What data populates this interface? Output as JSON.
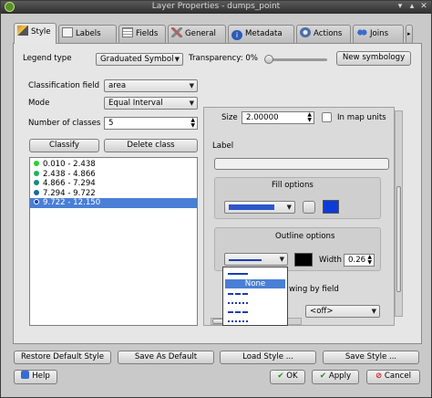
{
  "window": {
    "title": "Layer Properties - dumps_point"
  },
  "tabs": [
    {
      "label": "Style"
    },
    {
      "label": "Labels"
    },
    {
      "label": "Fields"
    },
    {
      "label": "General"
    },
    {
      "label": "Metadata"
    },
    {
      "label": "Actions"
    },
    {
      "label": "Joins"
    }
  ],
  "legend": {
    "label": "Legend type",
    "value": "Graduated Symbol",
    "transparency_label": "Transparency: 0%",
    "transparency": 0,
    "new_symbology": "New symbology"
  },
  "classification": {
    "field_label": "Classification field",
    "field_value": "area",
    "mode_label": "Mode",
    "mode_value": "Equal Interval",
    "classes_label": "Number of classes",
    "classes_value": "5",
    "classify": "Classify",
    "delete_class": "Delete class"
  },
  "classes": [
    {
      "label": "0.010 - 2.438",
      "color": "#2bd12b"
    },
    {
      "label": "2.438 - 4.866",
      "color": "#22b061"
    },
    {
      "label": "4.866 - 7.294",
      "color": "#178a7a"
    },
    {
      "label": "7.294 - 9.722",
      "color": "#156b9c"
    },
    {
      "label": "9.722 - 12.150",
      "color": "#1c3fc0"
    }
  ],
  "selected_class_index": 4,
  "symbol": {
    "size_label": "Size",
    "size_value": "2.00000",
    "in_map_units": "In map units",
    "label_label": "Label",
    "label_value": "",
    "fill_options": "Fill options",
    "fill_color": "#0e3bd8",
    "outline_options": "Outline options",
    "outline_color": "#000000",
    "width_label": "Width",
    "width_value": "0.26",
    "drawing_by_field": "wing by field",
    "off": "<off>"
  },
  "popup": {
    "none": "None"
  },
  "bottom": {
    "restore": "Restore Default Style",
    "save_default": "Save As Default",
    "load": "Load Style ...",
    "save": "Save Style ...",
    "help": "Help",
    "ok": "OK",
    "apply": "Apply",
    "cancel": "Cancel"
  }
}
